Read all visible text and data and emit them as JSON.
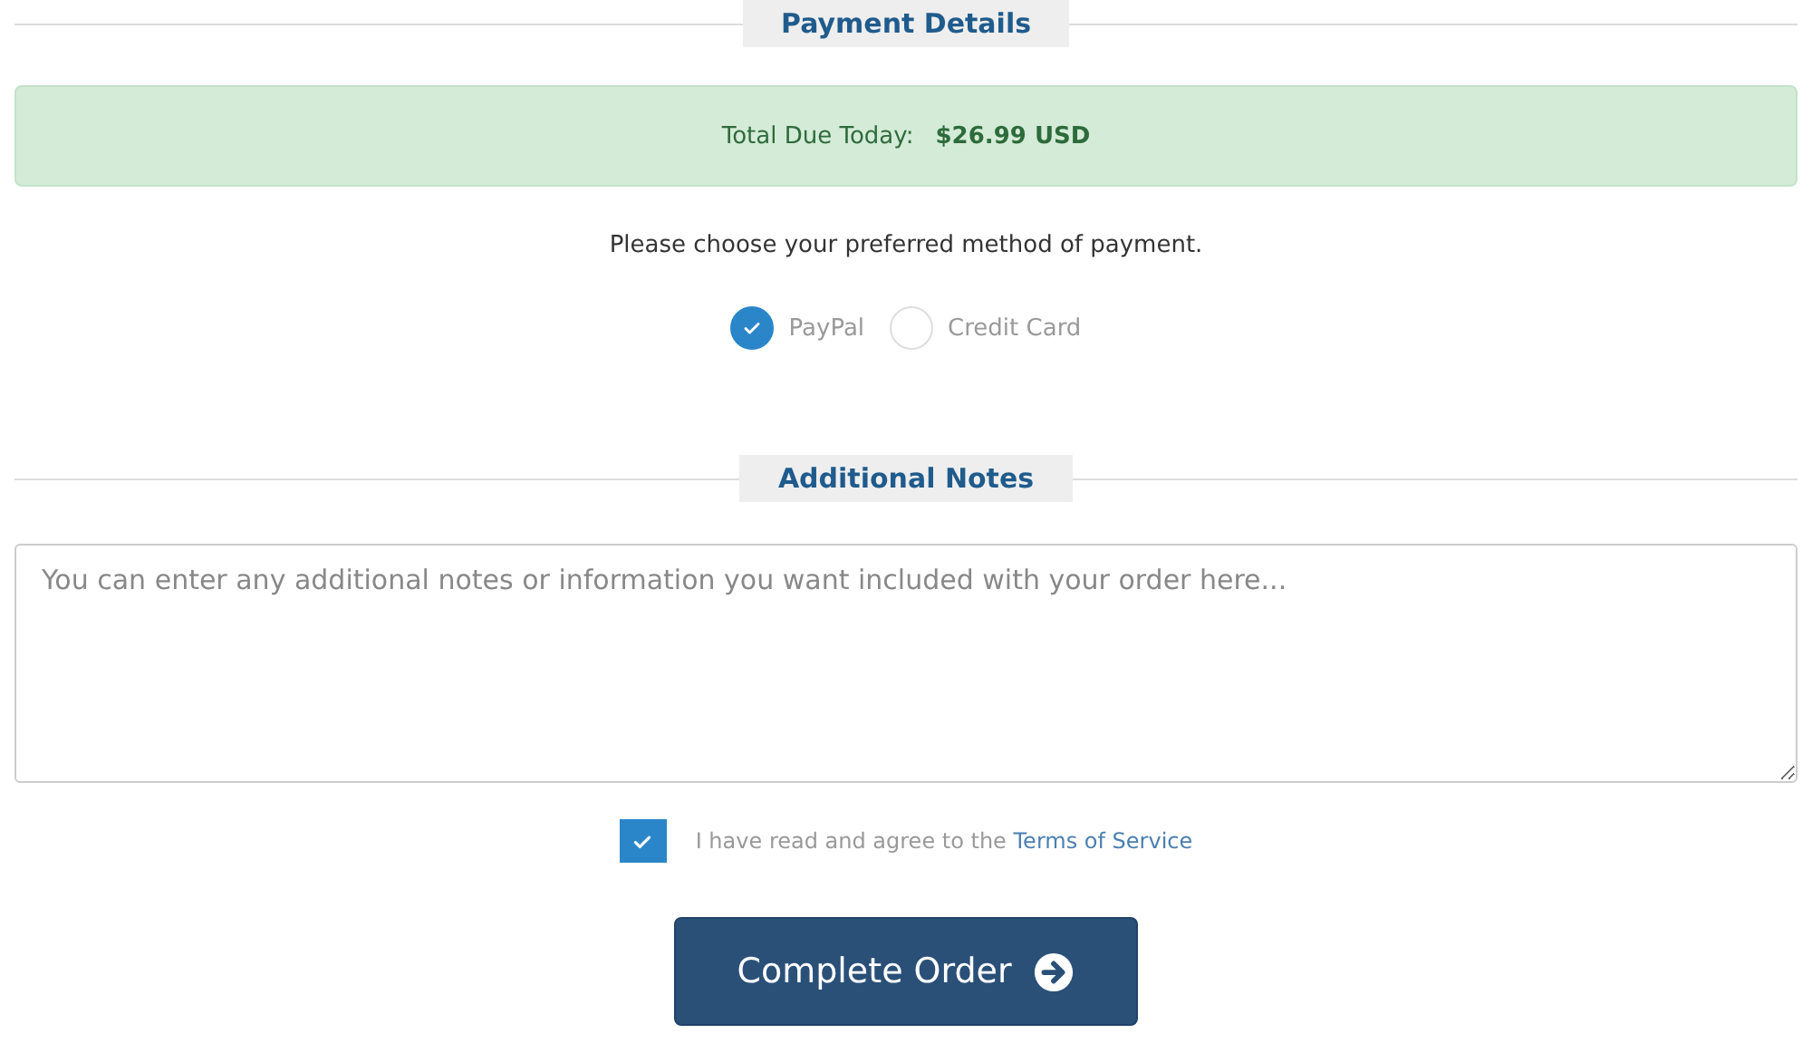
{
  "payment_heading": "Payment Details",
  "total": {
    "label": "Total Due Today:",
    "amount": "$26.99 USD"
  },
  "prompt": "Please choose your preferred method of payment.",
  "methods": [
    {
      "label": "PayPal",
      "selected": true
    },
    {
      "label": "Credit Card",
      "selected": false
    }
  ],
  "notes_heading": "Additional Notes",
  "notes": {
    "placeholder": "You can enter any additional notes or information you want included with your order here..."
  },
  "agree": {
    "checked": true,
    "text": "I have read and agree to the ",
    "link": "Terms of Service"
  },
  "submit": {
    "label": "Complete Order"
  }
}
